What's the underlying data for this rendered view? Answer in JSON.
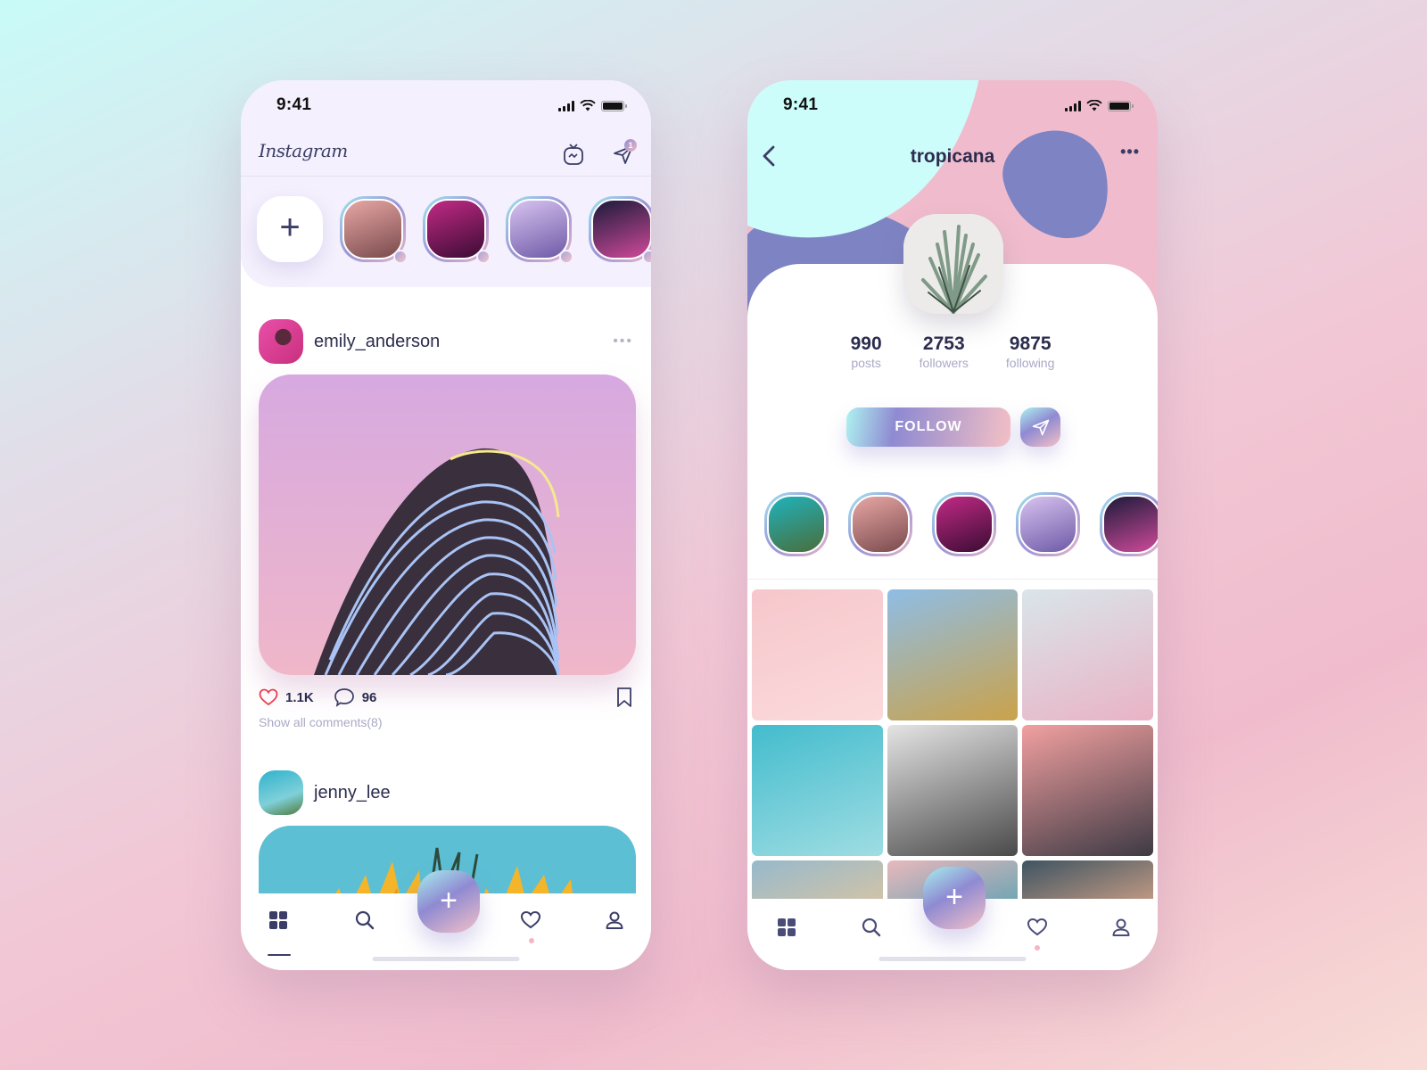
{
  "feed_screen": {
    "status": {
      "time": "9:41"
    },
    "header": {
      "logo": "Instagram",
      "igtv_icon": "igtv-icon",
      "direct_icon": "paper-plane-icon",
      "direct_badge": "1"
    },
    "stories": {
      "add_label": "+",
      "items": [
        {
          "name": "story-field",
          "colors": [
            "#e7a7a4",
            "#7a4a4d"
          ]
        },
        {
          "name": "story-neon",
          "colors": [
            "#c22a86",
            "#3a0c33"
          ]
        },
        {
          "name": "story-castle",
          "colors": [
            "#d7c3f0",
            "#6e5aa6"
          ]
        },
        {
          "name": "story-night-street",
          "colors": [
            "#1b1b3a",
            "#d04a9a"
          ]
        }
      ]
    },
    "posts": [
      {
        "username": "emily_anderson",
        "more": "•••",
        "likes": "1.1K",
        "comments": "96",
        "comments_link": "Show all comments(8)"
      },
      {
        "username": "jenny_lee"
      }
    ],
    "tabbar": {
      "items": [
        {
          "name": "home",
          "icon": "grid-icon",
          "active": true
        },
        {
          "name": "search",
          "icon": "search-icon",
          "active": false
        },
        {
          "name": "activity",
          "icon": "heart-icon",
          "active": false,
          "notification": true
        },
        {
          "name": "profile",
          "icon": "user-icon",
          "active": false
        }
      ],
      "fab_label": "+"
    }
  },
  "profile_screen": {
    "status": {
      "time": "9:41"
    },
    "header": {
      "title": "tropicana",
      "more": "•••"
    },
    "stats": [
      {
        "value": "990",
        "label": "posts"
      },
      {
        "value": "2753",
        "label": "followers"
      },
      {
        "value": "9875",
        "label": "following"
      }
    ],
    "follow_label": "FOLLOW",
    "highlights": [
      {
        "name": "highlight-palms",
        "colors": [
          "#1fb3bd",
          "#4a6d3a"
        ]
      },
      {
        "name": "highlight-field",
        "colors": [
          "#e7a7a4",
          "#7a4a4d"
        ]
      },
      {
        "name": "highlight-neon",
        "colors": [
          "#c22a86",
          "#3a0c33"
        ]
      },
      {
        "name": "highlight-castle",
        "colors": [
          "#d7c3f0",
          "#6e5aa6"
        ]
      },
      {
        "name": "highlight-night",
        "colors": [
          "#1b1b3a",
          "#d04a9a"
        ]
      }
    ],
    "grid": [
      {
        "name": "pink-clouds",
        "colors": [
          "#f6c7cc",
          "#fbdadb"
        ]
      },
      {
        "name": "palm-tree",
        "colors": [
          "#8fbde5",
          "#caa24a"
        ]
      },
      {
        "name": "beach-blanket",
        "colors": [
          "#d9e5ea",
          "#e9b3c5"
        ]
      },
      {
        "name": "ocean-horse",
        "colors": [
          "#43bccd",
          "#9fdde3"
        ]
      },
      {
        "name": "bw-palm-leaves",
        "colors": [
          "#e4e4e4",
          "#4a4a4a"
        ]
      },
      {
        "name": "temple-gate",
        "colors": [
          "#f2a0a0",
          "#3e3a44"
        ]
      },
      {
        "name": "sandy-water",
        "colors": [
          "#96b9cc",
          "#d4c4a6"
        ]
      },
      {
        "name": "teal-sky",
        "colors": [
          "#e8b8bc",
          "#6ba5b3"
        ]
      },
      {
        "name": "dusk-clouds",
        "colors": [
          "#3e5462",
          "#c79c84"
        ]
      }
    ],
    "tabbar": {
      "items": [
        {
          "name": "home",
          "icon": "grid-icon"
        },
        {
          "name": "search",
          "icon": "search-icon"
        },
        {
          "name": "activity",
          "icon": "heart-icon",
          "notification": true
        },
        {
          "name": "profile",
          "icon": "user-icon"
        }
      ],
      "fab_label": "+"
    }
  },
  "colors": {
    "primary_text": "#2b2c4e",
    "muted_text": "#aaa9c6",
    "accent_purple": "#7e83c4",
    "accent_pink": "#f0bccd",
    "accent_cyan": "#cdfdfa",
    "like_red": "#e8404d"
  }
}
